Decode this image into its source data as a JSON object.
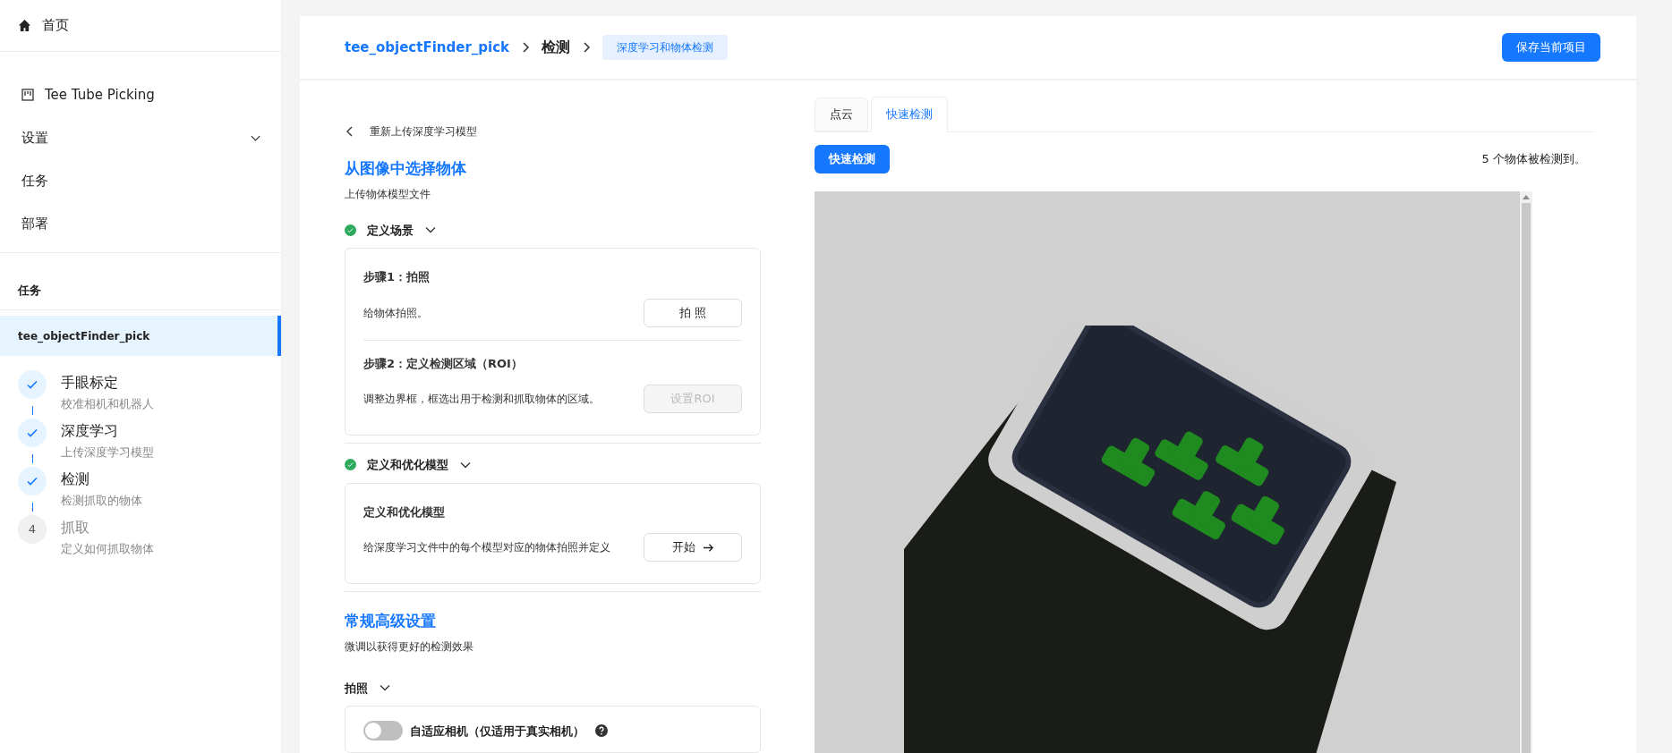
{
  "sidebar": {
    "home": "首页",
    "project": "Tee Tube Picking",
    "nav": [
      {
        "label": "设置",
        "expandable": true
      },
      {
        "label": "任务",
        "expandable": false
      },
      {
        "label": "部署",
        "expandable": false
      }
    ],
    "tasks_header": "任务",
    "tasks": [
      {
        "label": "tee_objectFinder_pick",
        "selected": true
      }
    ],
    "steps": [
      {
        "title": "手眼标定",
        "subtitle": "校准相机和机器人",
        "done": true
      },
      {
        "title": "深度学习",
        "subtitle": "上传深度学习模型",
        "done": true
      },
      {
        "title": "检测",
        "subtitle": "检测抓取的物体",
        "done": true
      },
      {
        "number": "4",
        "title": "抓取",
        "subtitle": "定义如何抓取物体",
        "done": false
      }
    ]
  },
  "breadcrumb": {
    "project": "tee_objectFinder_pick",
    "current": "检测",
    "tag": "深度学习和物体检测"
  },
  "save_button": "保存当前项目",
  "left": {
    "back": "重新上传深度学习模型",
    "title": "从图像中选择物体",
    "subtitle": "上传物体模型文件",
    "sections": [
      {
        "title": "定义场景",
        "complete": true,
        "rows": [
          {
            "title": "步骤1：拍照",
            "text": "给物体拍照。",
            "button": "拍 照",
            "disabled": false,
            "arrow": false
          },
          {
            "title": "步骤2：定义检测区域（ROI）",
            "text": "调整边界框，框选出用于检测和抓取物体的区域。",
            "button": "设置ROI",
            "disabled": true,
            "arrow": false
          }
        ]
      },
      {
        "title": "定义和优化模型",
        "complete": true,
        "rows": [
          {
            "title": "定义和优化模型",
            "text": "给深度学习文件中的每个模型对应的物体拍照并定义",
            "button": "开始",
            "disabled": false,
            "arrow": true
          }
        ]
      }
    ],
    "advanced": {
      "title": "常规高级设置",
      "subtitle": "微调以获得更好的检测效果",
      "group": "拍照",
      "toggle": {
        "label": "自适应相机（仅适用于真实相机）",
        "on": false
      }
    }
  },
  "right": {
    "tabs": [
      {
        "label": "点云",
        "selected": false
      },
      {
        "label": "快速检测",
        "selected": true
      }
    ],
    "detect_button": "快速检测",
    "result": "5 个物体被检测到。"
  }
}
